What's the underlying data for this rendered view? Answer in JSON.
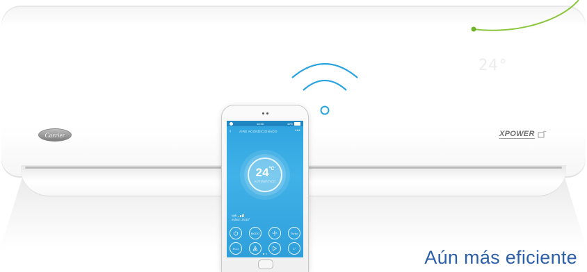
{
  "unit": {
    "brand_badge": "Carrier",
    "model_logo": "XPOWER",
    "display_temp": "24°"
  },
  "phone": {
    "status_time": "18:30",
    "status_battery": "42%",
    "header_title": "AIRE ACONDICIONADO",
    "temperature": "24",
    "temperature_unit": "°C",
    "mode": "AUTOMÁTICO",
    "wifi_label": "Wifi",
    "indoor_label": "Indoor: 24,50°",
    "buttons_row1": [
      "power-icon",
      "MODO",
      "fan-icon",
      "Turbo"
    ],
    "buttons_row2": [
      "ECO",
      "swing-icon",
      "direction-icon",
      "timer-icon"
    ],
    "turbo_label": "Turbo",
    "modo_label": "MODO",
    "eco_label": "ECO",
    "timer_label": "C°"
  },
  "tagline": "Aún más eficiente",
  "colors": {
    "accent_blue": "#2b5fa8",
    "wifi_blue": "#29a3e0",
    "green_accent": "#8cc63f",
    "screen_blue": "#40b2e8"
  }
}
